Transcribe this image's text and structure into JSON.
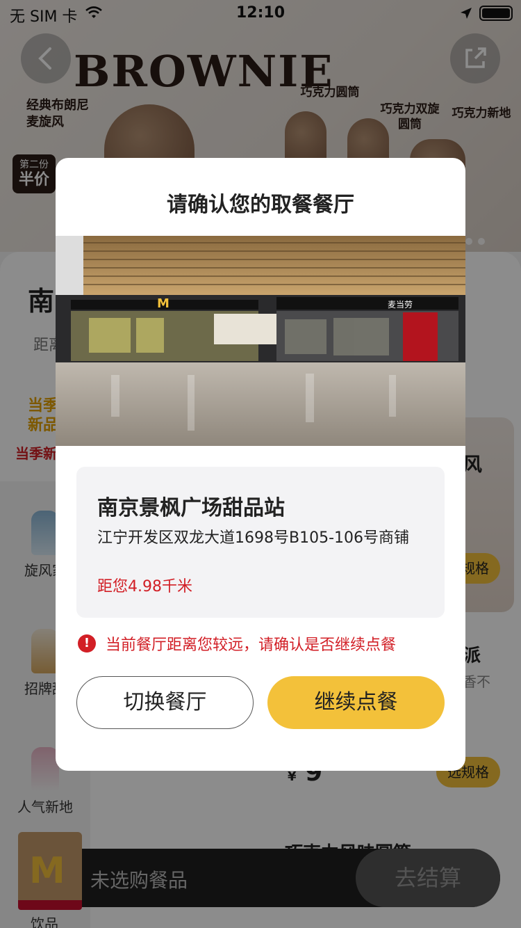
{
  "status_bar": {
    "carrier": "无 SIM 卡",
    "time": "12:10"
  },
  "banner": {
    "title": "BROWNIE",
    "product_main": "经典布朗尼麦旋风",
    "cones": [
      "巧克力圆筒",
      "巧克力双旋圆筒",
      "巧克力新地"
    ],
    "badge_top": "第二份",
    "badge_main": "半价"
  },
  "background_store": {
    "name_fragment": "南",
    "distance_fragment": "距离"
  },
  "season": {
    "tile_text": "当季新品",
    "label": "当季新"
  },
  "sidebar": {
    "items": [
      {
        "label": "旋风家"
      },
      {
        "label": "招牌甜"
      },
      {
        "label": "人气新地"
      },
      {
        "label": "饮品"
      }
    ]
  },
  "product_fragments": {
    "title_1": "风",
    "spec_label_1": "选规格",
    "title_2": "派",
    "desc_2": "香不",
    "price_symbol": "¥",
    "price": "9",
    "spec_label_2": "选规格",
    "title_3": "巧克力风味圆筒"
  },
  "cart": {
    "logo": "M",
    "empty_text": "未选购餐品",
    "checkout": "去结算"
  },
  "modal": {
    "title": "请确认您的取餐餐厅",
    "photo_sign_left": "M",
    "photo_sign_right": "麦当劳",
    "store_name": "南京景枫广场甜品站",
    "address": "江宁开发区双龙大道1698号B105-106号商铺",
    "distance": "距您4.98千米",
    "warning_icon": "!",
    "warning": "当前餐厅距离您较远，请确认是否继续点餐",
    "switch_button": "切换餐厅",
    "continue_button": "继续点餐"
  },
  "colors": {
    "accent_yellow": "#f3c13a",
    "warning_red": "#d21f26",
    "overlay": "rgba(0,0,0,0.45)"
  }
}
